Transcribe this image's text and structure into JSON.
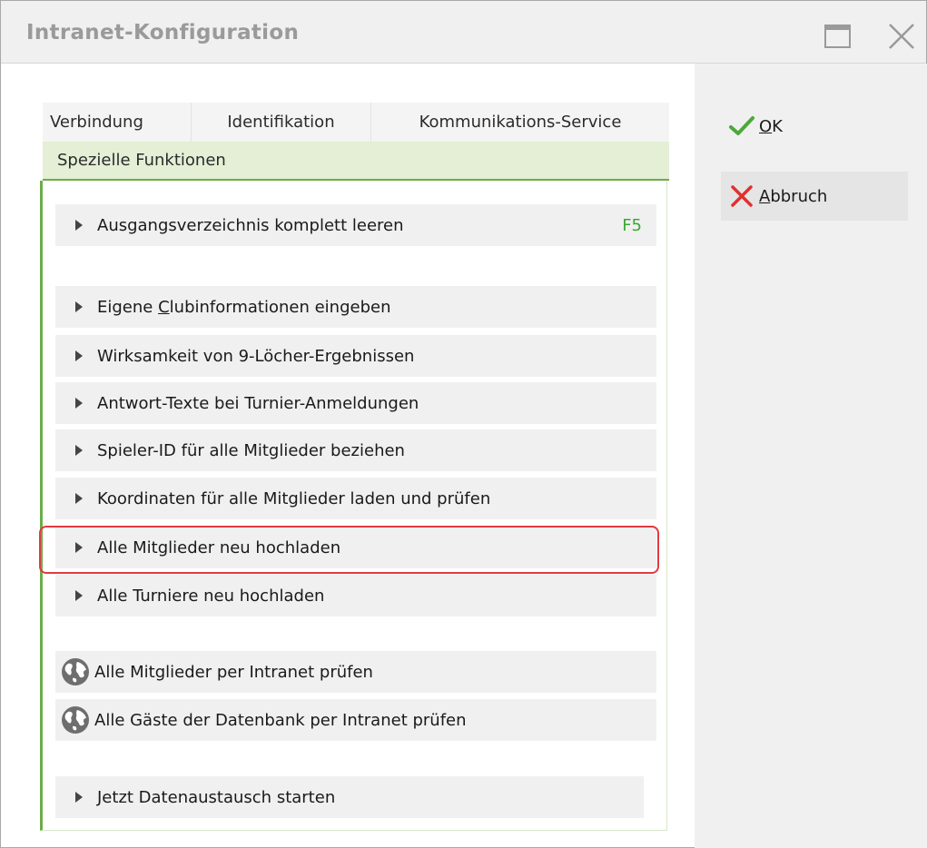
{
  "window": {
    "title": "Intranet-Konfiguration"
  },
  "tabs": [
    {
      "label": "Verbindung"
    },
    {
      "label": "Identifikation"
    },
    {
      "label": "Kommunikations-Service"
    }
  ],
  "active_tab": {
    "label": "Spezielle Funktionen"
  },
  "buttons": {
    "ok": {
      "mnemonic": "O",
      "rest": "K"
    },
    "cancel": {
      "mnemonic": "A",
      "rest": "bbruch"
    }
  },
  "items": {
    "clear_outbox": {
      "label": "Ausgangsverzeichnis komplett leeren",
      "shortcut": "F5"
    },
    "club_info": {
      "before": "Eigene ",
      "mnemonic": "C",
      "after": "lubinformationen eingeben"
    },
    "nine_holes": {
      "label": "Wirksamkeit von 9-Löcher-Ergebnissen"
    },
    "answer_texts": {
      "label": "Antwort-Texte bei Turnier-Anmeldungen"
    },
    "player_id": {
      "label": "Spieler-ID für alle Mitglieder beziehen"
    },
    "coordinates": {
      "label": "Koordinaten für alle Mitglieder laden und prüfen"
    },
    "upload_members": {
      "label": "Alle Mitglieder neu hochladen"
    },
    "upload_tournaments": {
      "label": "Alle Turniere neu hochladen"
    },
    "check_members": {
      "label": "Alle Mitglieder per Intranet prüfen"
    },
    "check_guests": {
      "label": "Alle Gäste der Datenbank per Intranet prüfen"
    },
    "start_exchange": {
      "label": "Jetzt Datenaustausch starten"
    }
  },
  "colors": {
    "accent_green": "#6cac4a",
    "active_tab_bg": "#e4efd6",
    "highlight_red": "#e23a3f",
    "shortcut_green": "#3aa832"
  },
  "icons": {
    "ok": "checkmark-icon",
    "cancel": "x-icon",
    "globe": "globe-icon",
    "arrow": "triangle-right-icon",
    "maximize": "maximize-icon",
    "close": "close-icon"
  }
}
